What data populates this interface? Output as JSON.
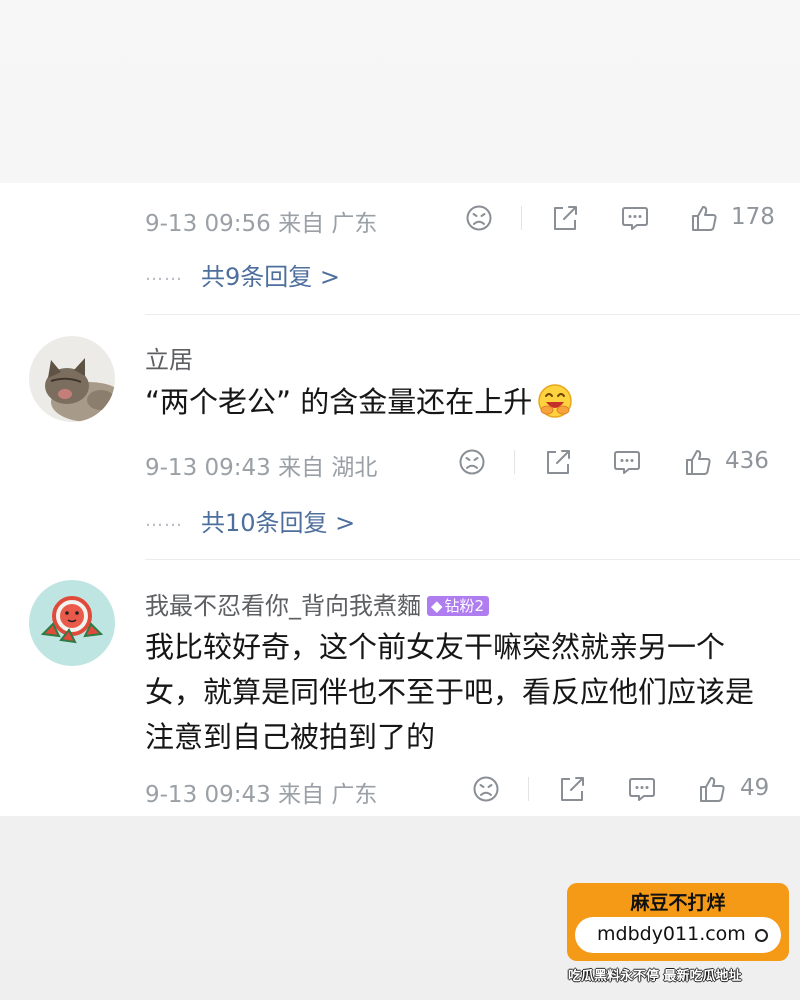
{
  "colors": {
    "meta_gray": "#9aa0a6",
    "reply_link": "#4e6f9e",
    "badge_purple": "#b07df0",
    "watermark_orange": "#f59a16"
  },
  "comments": [
    {
      "timestamp": "9-13 09:56",
      "location": "来自 广东",
      "likes": "178",
      "replies_dots": "……",
      "replies_text": "共9条回复 >"
    },
    {
      "username": "立居",
      "avatar_icon": "kitten-avatar",
      "text": "“两个老公” 的含金量还在上升",
      "emoji_icon": "grinning-face-emoji",
      "timestamp": "9-13 09:43",
      "location": "来自 湖北",
      "likes": "436",
      "replies_dots": "……",
      "replies_text": "共10条回复 >"
    },
    {
      "username": "我最不忍看你_背向我煮麵",
      "avatar_icon": "watermelon-avatar",
      "badge": "钻粉2",
      "badge_icon": "diamond-icon",
      "text": "我比较好奇，这个前女友干嘛突然就亲另一个女，就算是同伴也不至于吧，看反应他们应该是注意到自己被拍到了的",
      "timestamp": "9-13 09:43",
      "location": "来自 广东",
      "likes": "49"
    }
  ],
  "watermark": {
    "title": "麻豆不打烊",
    "url": "mdbdy011.com",
    "footer": "吃瓜黑料永不停 最新吃瓜地址"
  }
}
